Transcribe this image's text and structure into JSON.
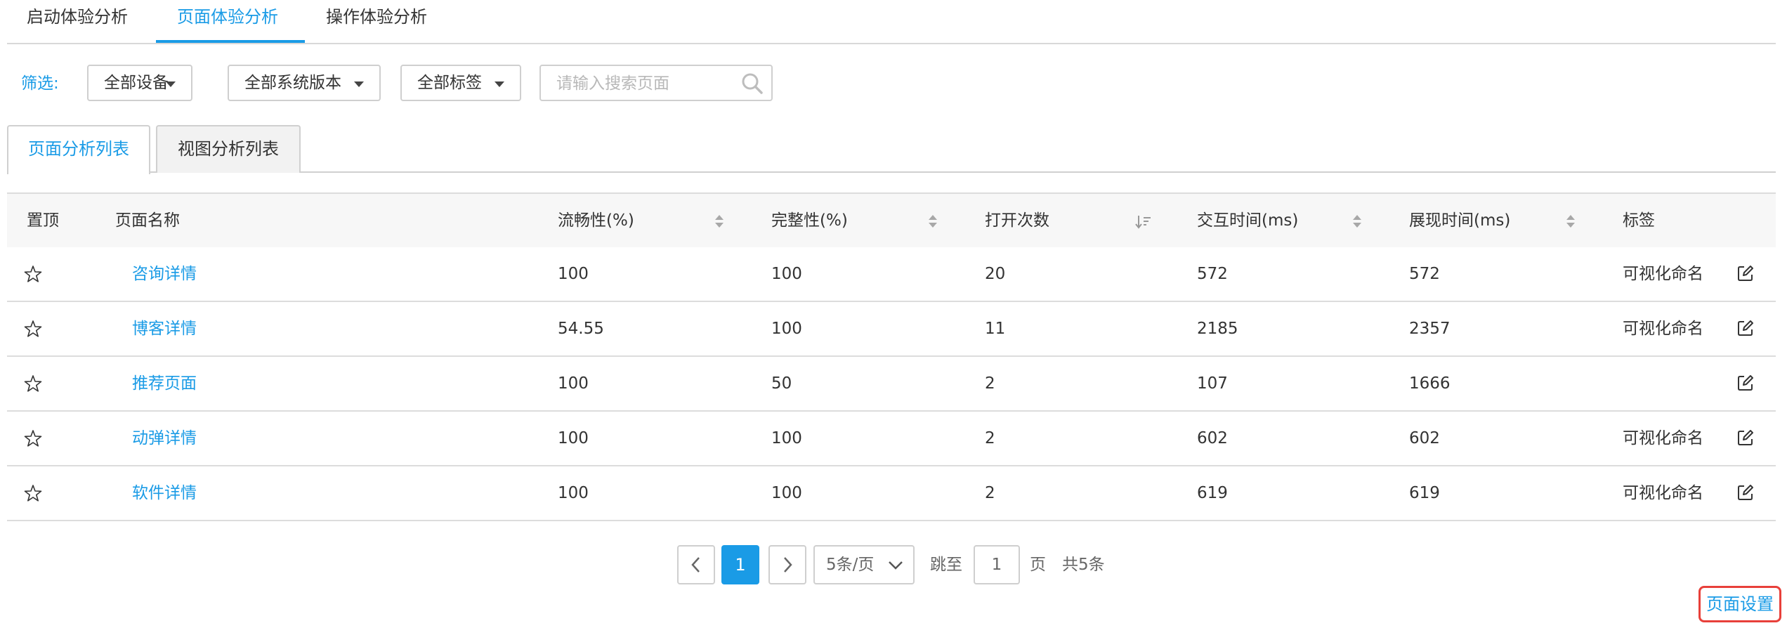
{
  "top_tabs": [
    {
      "label": "启动体验分析",
      "active": false
    },
    {
      "label": "页面体验分析",
      "active": true
    },
    {
      "label": "操作体验分析",
      "active": false
    }
  ],
  "filter": {
    "label": "筛选:",
    "device": "全部设备",
    "os_version": "全部系统版本",
    "tag": "全部标签",
    "search_placeholder": "请输入搜索页面",
    "search_value": ""
  },
  "sub_tabs": [
    {
      "label": "页面分析列表",
      "active": true
    },
    {
      "label": "视图分析列表",
      "active": false
    }
  ],
  "table": {
    "headers": {
      "pin": "置顶",
      "name": "页面名称",
      "fluency": "流畅性(%)",
      "integrity": "完整性(%)",
      "opens": "打开次数",
      "interaction": "交互时间(ms)",
      "display": "展现时间(ms)",
      "tag": "标签"
    },
    "rows": [
      {
        "name": "咨询详情",
        "fluency": "100",
        "integrity": "100",
        "opens": "20",
        "interaction": "572",
        "display": "572",
        "tag": "可视化命名"
      },
      {
        "name": "博客详情",
        "fluency": "54.55",
        "integrity": "100",
        "opens": "11",
        "interaction": "2185",
        "display": "2357",
        "tag": "可视化命名"
      },
      {
        "name": "推荐页面",
        "fluency": "100",
        "integrity": "50",
        "opens": "2",
        "interaction": "107",
        "display": "1666",
        "tag": ""
      },
      {
        "name": "动弹详情",
        "fluency": "100",
        "integrity": "100",
        "opens": "2",
        "interaction": "602",
        "display": "602",
        "tag": "可视化命名"
      },
      {
        "name": "软件详情",
        "fluency": "100",
        "integrity": "100",
        "opens": "2",
        "interaction": "619",
        "display": "619",
        "tag": "可视化命名"
      }
    ]
  },
  "pagination": {
    "current_page": "1",
    "page_size": "5条/页",
    "jump_label": "跳至",
    "jump_value": "1",
    "page_unit": "页",
    "total": "共5条"
  },
  "page_settings_label": "页面设置",
  "colors": {
    "accent": "#1a9be6",
    "highlight_border": "#e8403a",
    "header_bg": "#f7f7f7"
  }
}
